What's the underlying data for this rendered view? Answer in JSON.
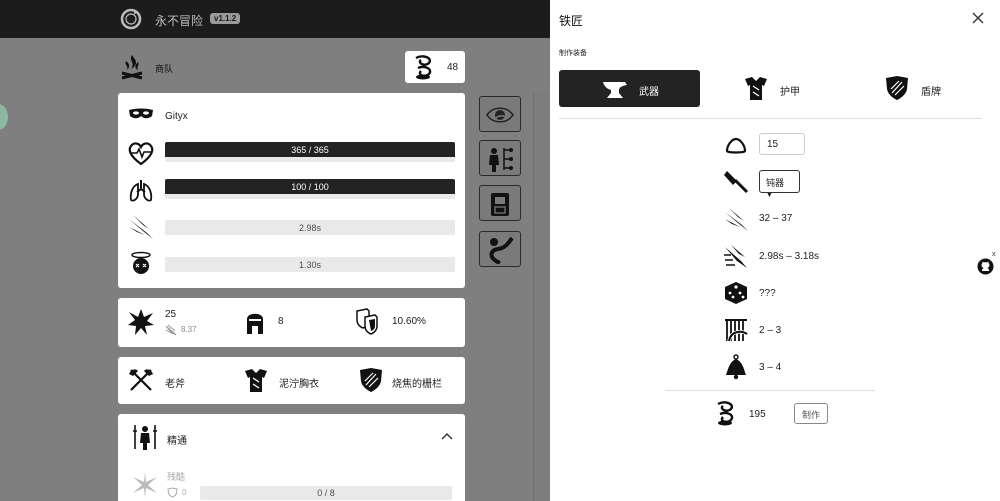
{
  "header": {
    "app_title": "永不冒险",
    "version": "v1.1.2"
  },
  "caravan": {
    "label": "商队",
    "gold": "48"
  },
  "character": {
    "name": "Gityx",
    "health": {
      "text": "365 / 365",
      "fraction": 1.0
    },
    "stamina": {
      "text": "100 / 100",
      "fraction": 1.0
    },
    "attack_speed": "2.98s",
    "recovery": "1.30s"
  },
  "stats": {
    "damage": "25",
    "damage_sub": "8.37",
    "protection": "8",
    "block": "10.60%"
  },
  "equipment": {
    "weapon": "老斧",
    "armor": "泥泞胸衣",
    "shield": "烧焦的栅栏"
  },
  "mastery": {
    "title": "精通",
    "sub_label": "残酷",
    "sub_count": "0",
    "progress": "0 / 8"
  },
  "blacksmith": {
    "title": "铁匠",
    "section_label": "制作装备",
    "tabs": [
      {
        "label": "武器"
      },
      {
        "label": "护甲"
      },
      {
        "label": "盾牌"
      }
    ],
    "gear_level": "15",
    "weapon_class": "钝器",
    "damage_range": "32 – 37",
    "speed_range": "2.98s – 3.18s",
    "random_stat": "???",
    "stat_a": "2 – 3",
    "stat_b": "3 – 4",
    "cost": "195",
    "craft_label": "制作"
  },
  "github_close": "x",
  "colors": {
    "dark": "#232323",
    "overlay": "#7f7f7f",
    "bar_bg": "#e9e9e9",
    "topbar": "#1c1c1c"
  }
}
